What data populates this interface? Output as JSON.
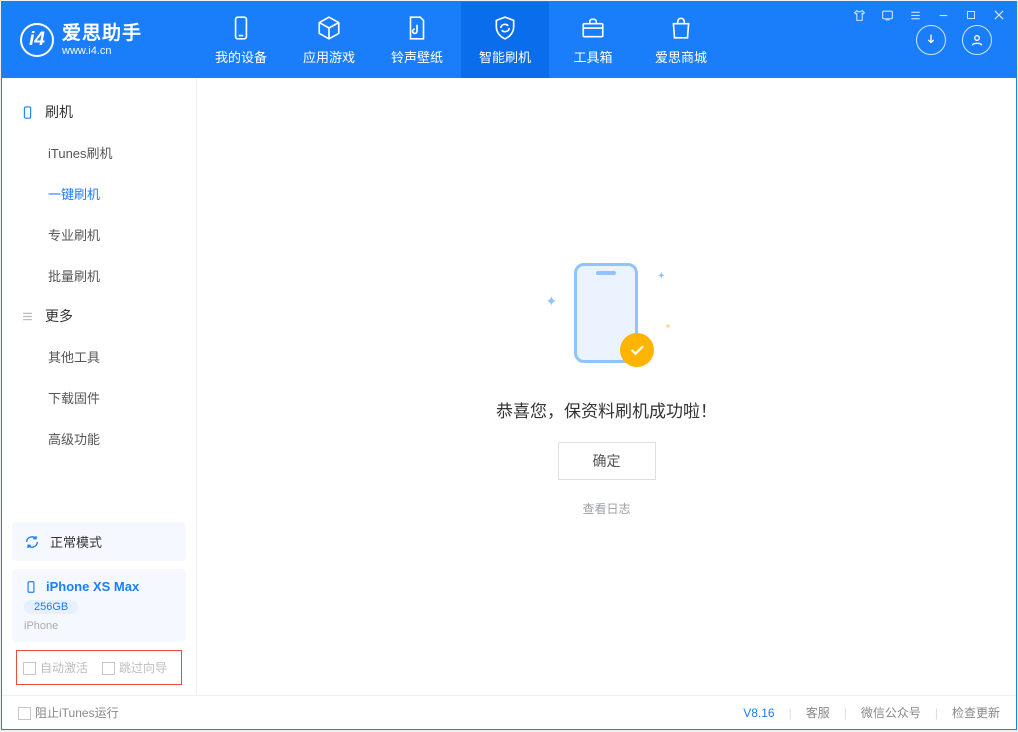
{
  "app": {
    "name_cn": "爱思助手",
    "name_en": "www.i4.cn"
  },
  "nav": {
    "tabs": [
      {
        "label": "我的设备"
      },
      {
        "label": "应用游戏"
      },
      {
        "label": "铃声壁纸"
      },
      {
        "label": "智能刷机"
      },
      {
        "label": "工具箱"
      },
      {
        "label": "爱思商城"
      }
    ],
    "active_index": 3
  },
  "sidebar": {
    "sections": [
      {
        "title": "刷机",
        "items": [
          "iTunes刷机",
          "一键刷机",
          "专业刷机",
          "批量刷机"
        ],
        "active_item": 1
      },
      {
        "title": "更多",
        "items": [
          "其他工具",
          "下载固件",
          "高级功能"
        ],
        "active_item": -1
      }
    ]
  },
  "device": {
    "mode": "正常模式",
    "name": "iPhone XS Max",
    "capacity": "256GB",
    "type": "iPhone"
  },
  "options": {
    "auto_activate": "自动激活",
    "skip_guide": "跳过向导"
  },
  "main": {
    "success_msg": "恭喜您，保资料刷机成功啦！",
    "ok_btn": "确定",
    "log_link": "查看日志"
  },
  "footer": {
    "block_itunes": "阻止iTunes运行",
    "version": "V8.16",
    "links": [
      "客服",
      "微信公众号",
      "检查更新"
    ]
  }
}
